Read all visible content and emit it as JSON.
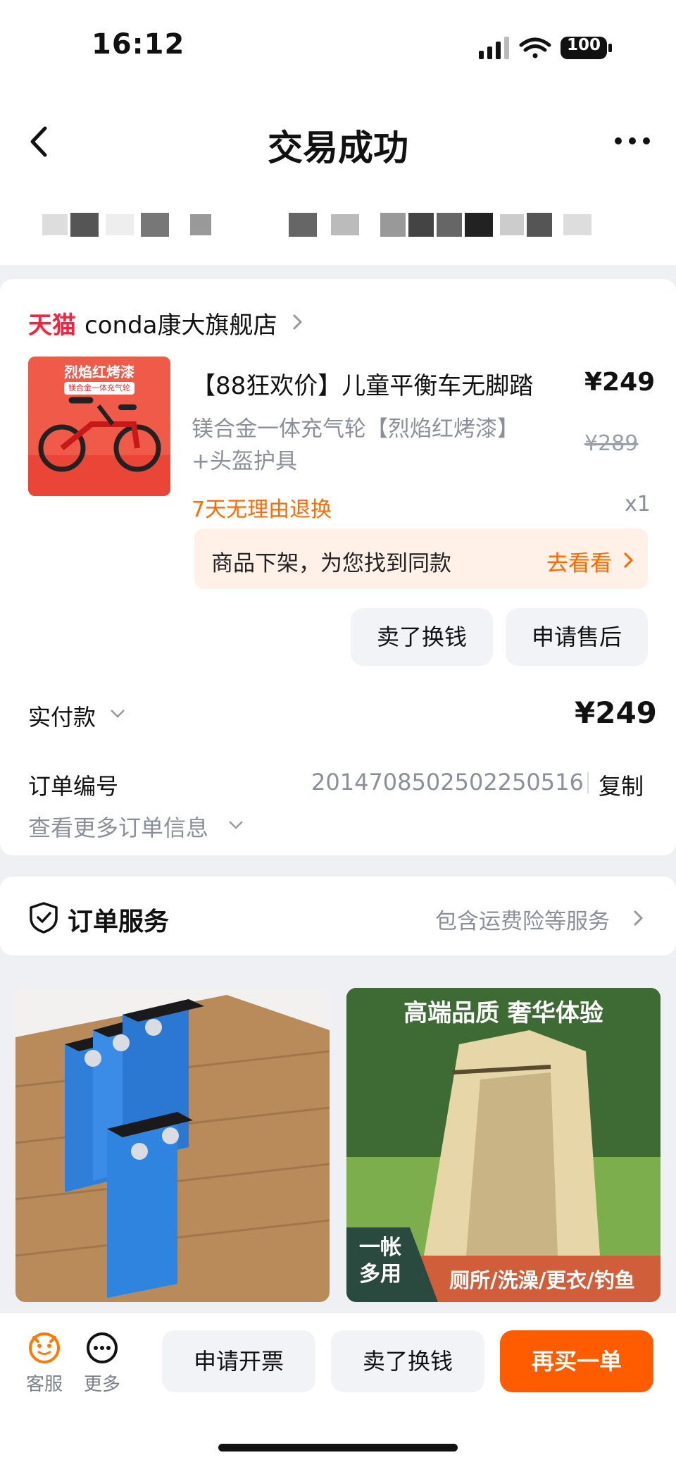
{
  "status_bar": {
    "time": "16:12",
    "battery": "100"
  },
  "nav": {
    "title": "交易成功"
  },
  "shop": {
    "platform": "天猫",
    "name": "conda康大旗舰店"
  },
  "product": {
    "title": "【88狂欢价】儿童平衡车无脚踏",
    "price": "¥249",
    "spec_line1": "镁合金一体充气轮【烈焰红烤漆】",
    "spec_line2": "+头盔护具",
    "original_price": "¥289",
    "return_policy": "7天无理由退换",
    "quantity": "x1",
    "thumb_label": "烈焰红烤漆",
    "thumb_sublabel": "镁合金一体充气轮"
  },
  "off_shelf": {
    "text": "商品下架，为您找到同款",
    "link": "去看看"
  },
  "actions": {
    "sell": "卖了换钱",
    "after_sale": "申请售后"
  },
  "payment": {
    "label": "实付款",
    "amount": "¥249"
  },
  "order": {
    "label": "订单编号",
    "number": "2014708502502250516",
    "copy": "复制",
    "more": "查看更多订单信息"
  },
  "service": {
    "title": "订单服务",
    "link": "包含运费险等服务"
  },
  "recommend": {
    "tile2_headline": "高端品质 奢华体验",
    "tile2_badge_line1": "一帐",
    "tile2_badge_line2": "多用",
    "tile2_uses": "厕所/洗澡/更衣/钓鱼"
  },
  "bottom_bar": {
    "service_label": "客服",
    "more_label": "更多",
    "invoice": "申请开票",
    "sell": "卖了换钱",
    "rebuy": "再买一单"
  },
  "colors": {
    "accent": "#ff5c00",
    "tmall_red": "#ff1f3a",
    "orange_text": "#ff6a00"
  }
}
